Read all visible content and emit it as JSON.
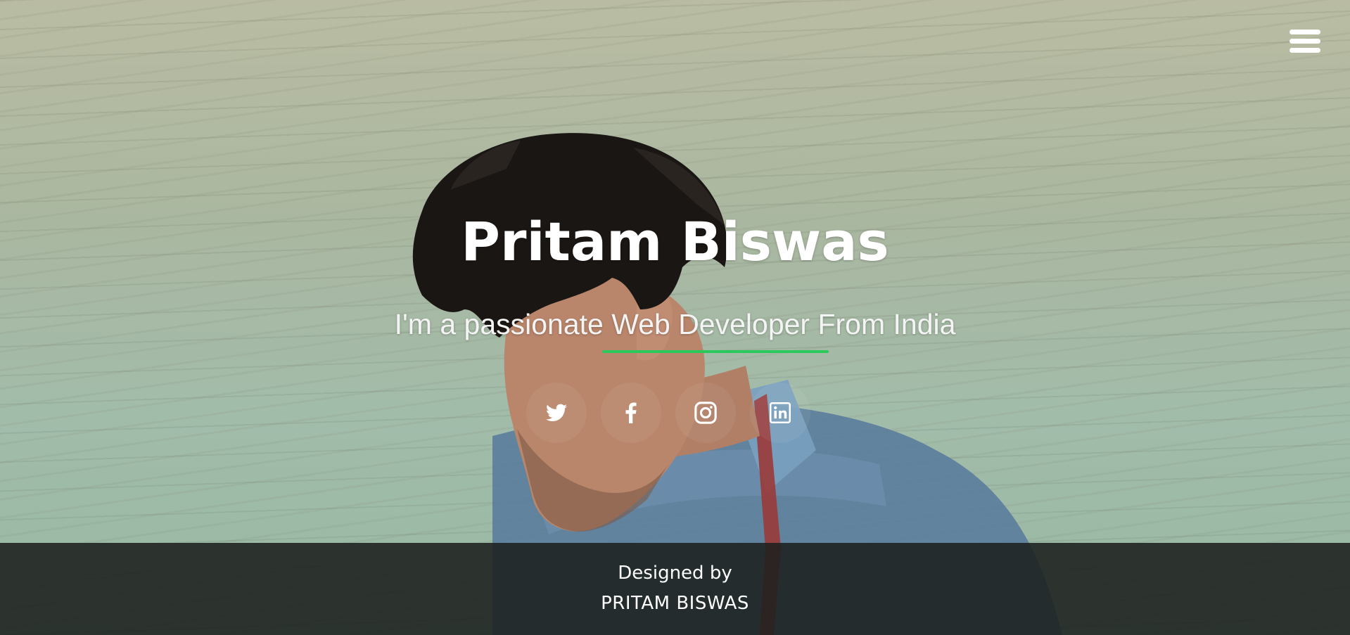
{
  "hero": {
    "name": "Pritam Biswas",
    "tagline": "I'm a passionate Web Developer From India",
    "accent_color": "#2bc85c",
    "photo": "portrait-photo"
  },
  "nav": {
    "menu_icon": "hamburger-menu-icon"
  },
  "socials": [
    {
      "icon": "twitter-icon"
    },
    {
      "icon": "facebook-icon"
    },
    {
      "icon": "instagram-icon"
    },
    {
      "icon": "linkedin-icon"
    }
  ],
  "footer": {
    "line1": "Designed by",
    "line2": "PRITAM BISWAS",
    "background_color": "#1c201e"
  }
}
